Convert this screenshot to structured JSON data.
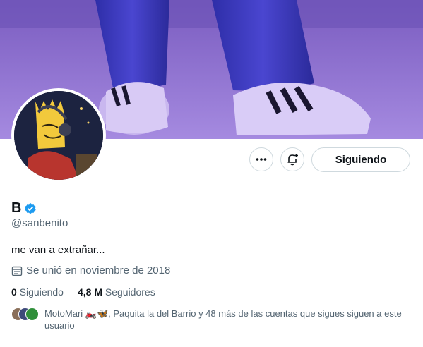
{
  "profile": {
    "display_name": "B",
    "handle": "@sanbenito",
    "bio": "me van a extrañar...",
    "joined": "Se unió en noviembre de 2018",
    "following_count": "0",
    "following_label": "Siguiendo",
    "followers_count": "4,8 M",
    "followers_label": "Seguidores",
    "known_followers": "MotoMari 🏍️🦋, Paquita la del Barrio y 48 más de las cuentas que sigues siguen a este usuario"
  },
  "actions": {
    "more_icon": "more-icon",
    "notify_icon": "bell-plus-icon",
    "follow_label": "Siguiendo"
  },
  "colors": {
    "verified": "#1d9bf0",
    "border": "#cfd9de",
    "muted_text": "#536471"
  }
}
